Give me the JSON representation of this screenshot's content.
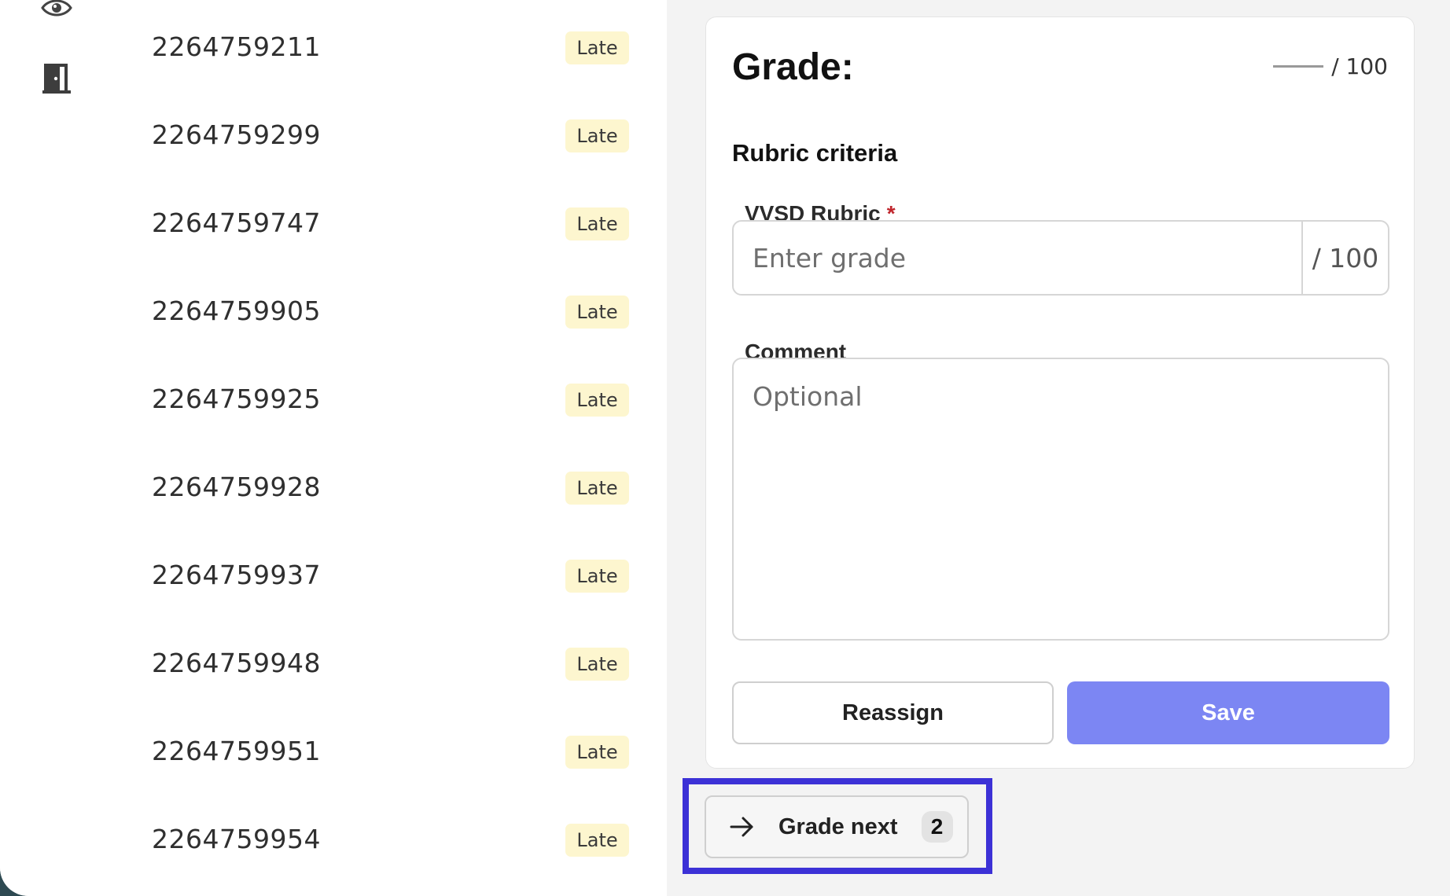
{
  "sidebar": {
    "icons": [
      "eye-icon",
      "door-exit-icon"
    ]
  },
  "submissions": [
    {
      "id": "2264759211",
      "status": "Late"
    },
    {
      "id": "2264759299",
      "status": "Late"
    },
    {
      "id": "2264759747",
      "status": "Late"
    },
    {
      "id": "2264759905",
      "status": "Late"
    },
    {
      "id": "2264759925",
      "status": "Late"
    },
    {
      "id": "2264759928",
      "status": "Late"
    },
    {
      "id": "2264759937",
      "status": "Late"
    },
    {
      "id": "2264759948",
      "status": "Late"
    },
    {
      "id": "2264759951",
      "status": "Late"
    },
    {
      "id": "2264759954",
      "status": "Late"
    }
  ],
  "grade_panel": {
    "title": "Grade:",
    "total": "/ 100",
    "rubric_heading": "Rubric criteria",
    "rubric_name": "VVSD Rubric",
    "required_marker": "*",
    "grade_placeholder": "Enter grade",
    "grade_suffix": "/ 100",
    "comment_label": "Comment",
    "comment_placeholder": "Optional",
    "reassign_label": "Reassign",
    "save_label": "Save"
  },
  "grade_next": {
    "label": "Grade next",
    "count": "2"
  },
  "colors": {
    "late_badge_bg": "#fdf6cf",
    "save_button_bg": "#7c86f3",
    "highlight_border": "#3c31d6",
    "required_marker": "#c0262d"
  }
}
